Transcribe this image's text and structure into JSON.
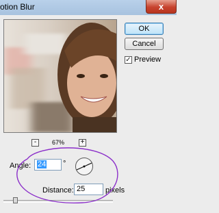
{
  "window": {
    "title": "otion Blur",
    "close_label": "x"
  },
  "buttons": {
    "ok_label": "OK",
    "cancel_label": "Cancel"
  },
  "preview_option": {
    "label": "Preview",
    "checked": true,
    "check_glyph": "✓"
  },
  "zoom": {
    "minus_label": "-",
    "level": "67%",
    "plus_label": "+"
  },
  "angle": {
    "label": "Angle:",
    "value": "24",
    "unit": "°"
  },
  "distance": {
    "label": "Distance:",
    "value": "25",
    "unit": "pixels"
  },
  "colors": {
    "annotation": "#8b2fc9",
    "selection": "#3399ff",
    "title_bar": "#b9d1ea"
  }
}
